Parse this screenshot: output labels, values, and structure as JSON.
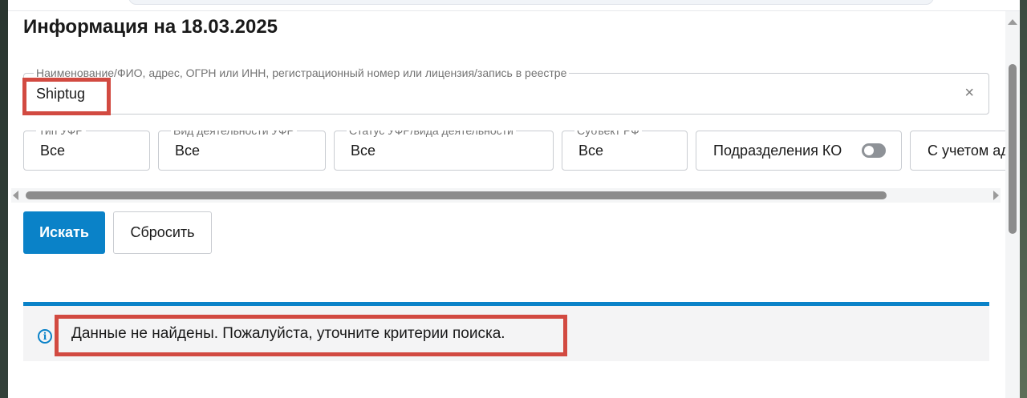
{
  "page": {
    "title": "Информация на 18.03.2025"
  },
  "search": {
    "label": "Наименование/ФИО, адрес, ОГРН или ИНН, регистрационный номер или лицензия/запись в реестре",
    "value": "Shiptug",
    "clear_icon": "×"
  },
  "filters": [
    {
      "label": "Тип УФР",
      "value": "Все"
    },
    {
      "label": "Вид деятельности УФР",
      "value": "Все"
    },
    {
      "label": "Статус УФР/вида деятельности",
      "value": "Все"
    },
    {
      "label": "Субъект РФ",
      "value": "Все"
    }
  ],
  "toggle": {
    "label": "Подразделения КО",
    "state": "off"
  },
  "extra_filter": {
    "label": "С учетом ад"
  },
  "buttons": {
    "search": "Искать",
    "reset": "Сбросить"
  },
  "result": {
    "icon": "i",
    "message": "Данные не найдены. Пожалуйста, уточните критерии поиска."
  },
  "colors": {
    "accent": "#0a82c8",
    "highlight": "#d24a41"
  }
}
